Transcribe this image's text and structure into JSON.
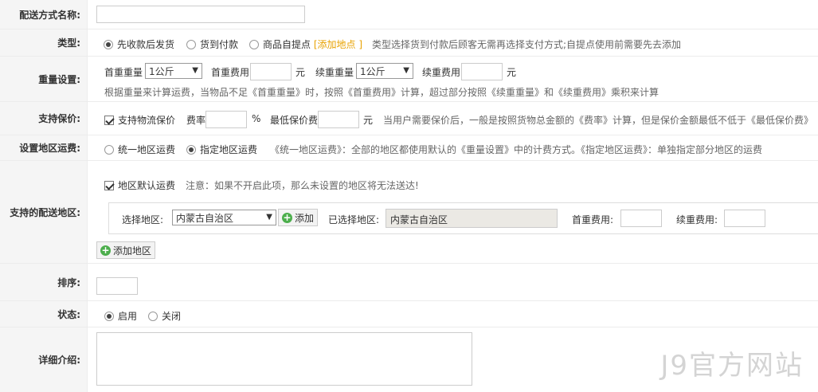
{
  "labels": {
    "name": "配送方式名称:",
    "type": "类型:",
    "weight": "重量设置:",
    "insure": "支持保价:",
    "area_fee": "设置地区运费:",
    "regions": "支持的配送地区:",
    "sort": "排序:",
    "status": "状态:",
    "desc": "详细介绍:"
  },
  "type": {
    "options": [
      "先收款后发货",
      "货到付款",
      "商品自提点"
    ],
    "selected": 0,
    "add_point_open": "[",
    "add_point": "添加地点",
    "add_point_close": "]",
    "hint": "类型选择货到付款后顾客无需再选择支付方式;自提点使用前需要先去添加"
  },
  "weight": {
    "first_weight_label": "首重重量",
    "first_weight_value": "1公斤",
    "first_fee_label": "首重费用",
    "yuan": "元",
    "cont_weight_label": "续重重量",
    "cont_weight_value": "1公斤",
    "cont_fee_label": "续重费用",
    "hint": "根据重量来计算运费，当物品不足《首重重量》时，按照《首重费用》计算，超过部分按照《续重重量》和《续重费用》乘积来计算"
  },
  "insure": {
    "checkbox_label": "支持物流保价",
    "rate_label": "费率",
    "percent": "%",
    "min_label": "最低保价费",
    "yuan": "元",
    "hint": "当用户需要保价后，一般是按照货物总金额的《费率》计算，但是保价金额最低不低于《最低保价费》"
  },
  "area_fee": {
    "options": [
      "统一地区运费",
      "指定地区运费"
    ],
    "selected": 1,
    "hint": "《统一地区运费》：全部的地区都使用默认的《重量设置》中的计费方式。《指定地区运费》：单独指定部分地区的运费"
  },
  "regions": {
    "default_label": "地区默认运费",
    "default_hint": "注意：如果不开启此项，那么未设置的地区将无法送达!",
    "select_label": "选择地区:",
    "select_value": "内蒙古自治区",
    "add_btn": "添加",
    "selected_label": "已选择地区:",
    "selected_value": "内蒙古自治区",
    "first_fee_label": "首重费用:",
    "cont_fee_label": "续重费用:",
    "add_region_btn": "添加地区"
  },
  "status": {
    "options": [
      "启用",
      "关闭"
    ],
    "selected": 0
  },
  "watermark": "J9官方网站"
}
